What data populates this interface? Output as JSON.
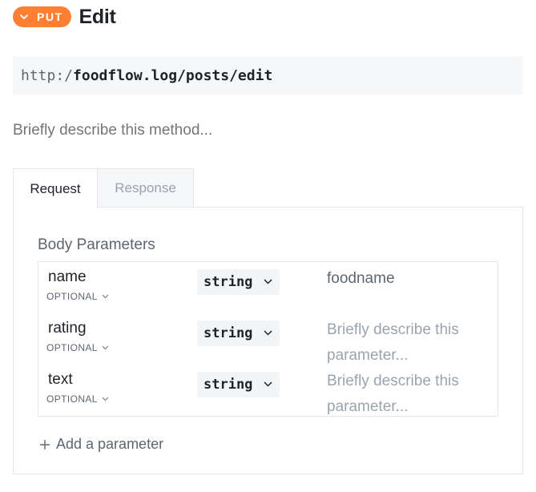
{
  "header": {
    "method": "PUT",
    "title": "Edit"
  },
  "url": {
    "prefix": "http:/",
    "path": "foodflow.log/posts/edit"
  },
  "method_description_placeholder": "Briefly describe this method...",
  "tabs": [
    {
      "label": "Request",
      "active": true
    },
    {
      "label": "Response",
      "active": false
    }
  ],
  "request": {
    "section_title": "Body Parameters",
    "parameters": [
      {
        "name": "name",
        "requirement": "OPTIONAL",
        "type": "string",
        "description": "foodname",
        "is_placeholder": false
      },
      {
        "name": "rating",
        "requirement": "OPTIONAL",
        "type": "string",
        "description": "Briefly describe this parameter...",
        "is_placeholder": true
      },
      {
        "name": "text",
        "requirement": "OPTIONAL",
        "type": "string",
        "description": "Briefly describe this parameter...",
        "is_placeholder": true
      }
    ],
    "add_label": "Add a parameter"
  },
  "colors": {
    "method_badge": "#ff7f32",
    "placeholder_text": "#9aa3ad",
    "border": "#e3e5e8"
  },
  "icons": {
    "method_toggle": "chevron-down-icon",
    "optional_toggle": "chevron-down-icon",
    "type_dropdown": "chevron-down-icon",
    "add": "plus-icon"
  }
}
